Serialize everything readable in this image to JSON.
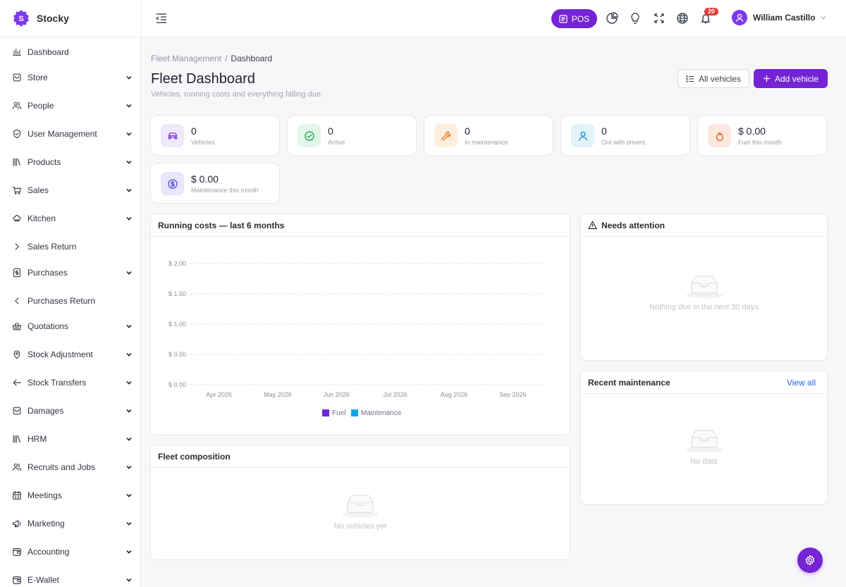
{
  "app": {
    "name": "Stocky"
  },
  "sidebar": {
    "items": [
      {
        "label": "Dashboard",
        "icon": "bar-chart-icon",
        "expandable": false
      },
      {
        "label": "Store",
        "icon": "store-icon",
        "expandable": true
      },
      {
        "label": "People",
        "icon": "people-icon",
        "expandable": true
      },
      {
        "label": "User Management",
        "icon": "shield-icon",
        "expandable": true
      },
      {
        "label": "Products",
        "icon": "books-icon",
        "expandable": true
      },
      {
        "label": "Sales",
        "icon": "cart-icon",
        "expandable": true
      },
      {
        "label": "Kitchen",
        "icon": "chef-hat-icon",
        "expandable": true
      },
      {
        "label": "Sales Return",
        "icon": "chevron-right-icon",
        "expandable": false
      },
      {
        "label": "Purchases",
        "icon": "receipt-icon",
        "expandable": true
      },
      {
        "label": "Purchases Return",
        "icon": "chevron-left-icon",
        "expandable": false
      },
      {
        "label": "Quotations",
        "icon": "basket-icon",
        "expandable": true
      },
      {
        "label": "Stock Adjustment",
        "icon": "map-pin-icon",
        "expandable": true
      },
      {
        "label": "Stock Transfers",
        "icon": "arrow-left-icon",
        "expandable": true
      },
      {
        "label": "Damages",
        "icon": "store-icon",
        "expandable": true
      },
      {
        "label": "HRM",
        "icon": "library-icon",
        "expandable": true
      },
      {
        "label": "Recruits and Jobs",
        "icon": "people-icon",
        "expandable": true
      },
      {
        "label": "Meetings",
        "icon": "calendar-icon",
        "expandable": true
      },
      {
        "label": "Marketing",
        "icon": "megaphone-icon",
        "expandable": true
      },
      {
        "label": "Accounting",
        "icon": "wallet-icon",
        "expandable": true
      },
      {
        "label": "E-Wallet",
        "icon": "wallet-icon",
        "expandable": true
      }
    ]
  },
  "topbar": {
    "pos_label": "POS",
    "notifications_count": "20",
    "user_name": "William Castillo"
  },
  "breadcrumb": {
    "parent": "Fleet Management",
    "separator": "/",
    "current": "Dashboard"
  },
  "page": {
    "title": "Fleet Dashboard",
    "subtitle": "Vehicles, running costs and everything falling due.",
    "all_vehicles_label": "All vehicles",
    "add_vehicle_label": "Add vehicle"
  },
  "stats": [
    {
      "value": "0",
      "label": "Vehicles",
      "icon": "car-icon",
      "bg": "#ede9fb",
      "fg": "#7c3aed"
    },
    {
      "value": "0",
      "label": "Active",
      "icon": "check-circle-icon",
      "bg": "#e3f6ea",
      "fg": "#16a34a"
    },
    {
      "value": "0",
      "label": "In maintenance",
      "icon": "wrench-icon",
      "bg": "#fdeedd",
      "fg": "#ea7a18"
    },
    {
      "value": "0",
      "label": "Out with drivers",
      "icon": "person-icon",
      "bg": "#e1f2f8",
      "fg": "#0e8fb5"
    },
    {
      "value": "$ 0.00",
      "label": "Fuel this month",
      "icon": "flame-icon",
      "bg": "#fde8df",
      "fg": "#e65a24"
    },
    {
      "value": "$ 0.00",
      "label": "Maintenance this month",
      "icon": "dollar-circle-icon",
      "bg": "#e7e6fb",
      "fg": "#5b48d6"
    }
  ],
  "running_costs": {
    "title": "Running costs — last 6 months"
  },
  "chart_data": {
    "type": "bar",
    "categories": [
      "Apr 2026",
      "May 2026",
      "Jun 2026",
      "Jul 2026",
      "Aug 2026",
      "Sep 2026"
    ],
    "series": [
      {
        "name": "Fuel",
        "values": [
          0,
          0,
          0,
          0,
          0,
          0
        ],
        "color": "#6d28d9"
      },
      {
        "name": "Maintenance",
        "values": [
          0,
          0,
          0,
          0,
          0,
          0
        ],
        "color": "#0ea5e9"
      }
    ],
    "yticks": [
      "$ 0.00",
      "$ 0.50",
      "$ 1.00",
      "$ 1.50",
      "$ 2.00"
    ],
    "ylim": [
      0,
      2
    ],
    "grid": true,
    "legend_position": "bottom"
  },
  "needs_attention": {
    "title": "Needs attention",
    "empty_text": "Nothing due in the next 30 days"
  },
  "recent_maintenance": {
    "title": "Recent maintenance",
    "view_all": "View all",
    "empty_text": "No data"
  },
  "fleet_composition": {
    "title": "Fleet composition",
    "empty_text": "No vehicles yet"
  }
}
